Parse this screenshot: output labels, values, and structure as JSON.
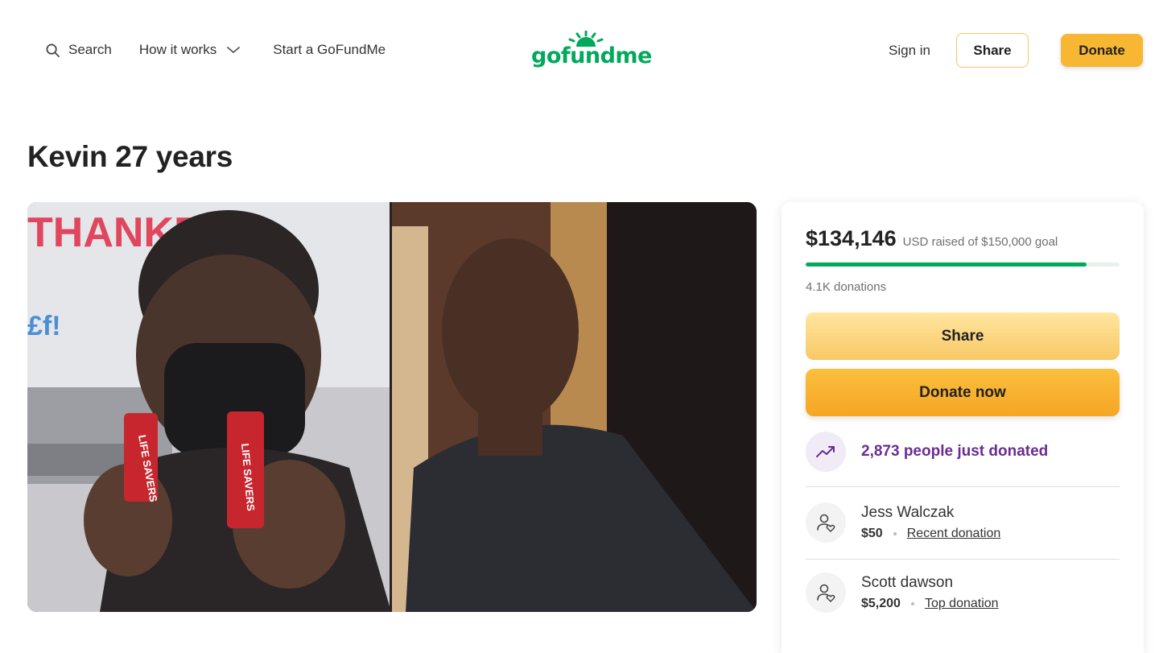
{
  "header": {
    "search_label": "Search",
    "how_it_works_label": "How it works",
    "start_label": "Start a GoFundMe",
    "logo_text": "gofundme",
    "signin_label": "Sign in",
    "share_label": "Share",
    "donate_label": "Donate"
  },
  "campaign": {
    "title": "Kevin 27 years",
    "photo_text": [
      "THANKFUL",
      "£f!",
      "LIFE SAVERS",
      "LIFE SAVERS"
    ]
  },
  "card": {
    "raised_amount": "$134,146",
    "raised_meta": "USD raised of $150,000 goal",
    "progress_fraction": 0.894,
    "donations_count": "4.1K donations",
    "share_label": "Share",
    "donate_label": "Donate now",
    "recent_text": "2,873 people just donated",
    "donors": [
      {
        "name": "Jess Walczak",
        "amount": "$50",
        "tag": "Recent donation"
      },
      {
        "name": "Scott dawson",
        "amount": "$5,200",
        "tag": "Top donation"
      }
    ]
  },
  "colors": {
    "brand_green": "#02a95c",
    "donate_orange": "#f7b733",
    "share_yellow": "#f8c865",
    "recent_purple": "#6a2c91"
  },
  "icons": [
    "search-icon",
    "chevron-down-icon",
    "sun-logo-icon",
    "trending-up-icon",
    "donor-heart-icon"
  ]
}
